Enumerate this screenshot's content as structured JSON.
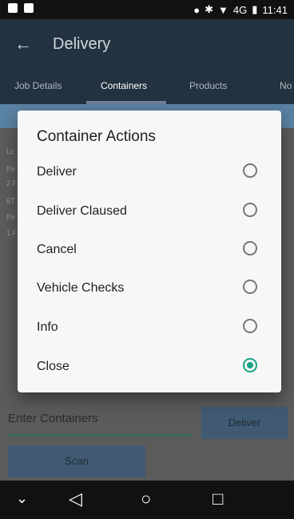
{
  "status_bar": {
    "time": "11:41",
    "network": "4G"
  },
  "app_bar": {
    "title": "Delivery"
  },
  "tabs": [
    {
      "label": "Job Details"
    },
    {
      "label": "Containers"
    },
    {
      "label": "Products"
    },
    {
      "label": "No"
    }
  ],
  "background_list": {
    "items": [
      "Lc",
      "Pe",
      "2 F",
      "6T",
      "Pe",
      "1 F"
    ]
  },
  "bottom_form": {
    "input_placeholder": "Enter Containers",
    "deliver_label": "Deliver",
    "scan_label": "Scan"
  },
  "dialog": {
    "title": "Container Actions",
    "options": [
      {
        "label": "Deliver",
        "selected": false
      },
      {
        "label": "Deliver Claused",
        "selected": false
      },
      {
        "label": "Cancel",
        "selected": false
      },
      {
        "label": "Vehicle Checks",
        "selected": false
      },
      {
        "label": "Info",
        "selected": false
      },
      {
        "label": "Close",
        "selected": true
      }
    ]
  },
  "colors": {
    "accent": "#13a384",
    "app_bar": "#233240",
    "tab_strip": "#5a82a3"
  }
}
